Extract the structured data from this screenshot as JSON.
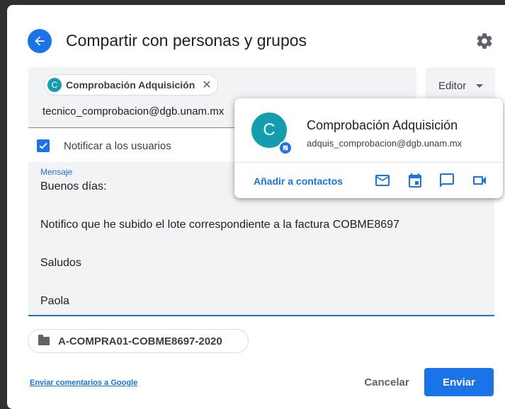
{
  "dialog": {
    "title": "Compartir con personas y grupos",
    "back_icon": "arrow-back-icon",
    "settings_icon": "gear-icon"
  },
  "recipients": {
    "chip": {
      "avatar_letter": "C",
      "label": "Comprobación Adquisición",
      "remove_icon": "close-icon"
    },
    "typed_value": "tecnico_comprobacion@dgb.unam.mx"
  },
  "role": {
    "selected": "Editor"
  },
  "notify": {
    "checked": true,
    "label": "Notificar a los usuarios"
  },
  "message": {
    "label": "Mensaje",
    "lines": [
      "Buenos días:",
      "Notifico que he subido el lote correspondiente a la factura COBME8697",
      "Saludos",
      "Paola"
    ]
  },
  "file": {
    "name": "A-COMPRA01-COBME8697-2020",
    "icon": "folder-icon"
  },
  "footer": {
    "feedback_link": "Enviar comentarios a Google",
    "cancel_label": "Cancelar",
    "send_label": "Enviar"
  },
  "contact_card": {
    "avatar_letter": "C",
    "name": "Comprobación Adquisición",
    "email": "adquis_comprobacion@dgb.unam.mx",
    "add_contacts_label": "Añadir a contactos",
    "actions": [
      "mail-icon",
      "calendar-icon",
      "chat-icon",
      "video-icon"
    ]
  },
  "colors": {
    "accent": "#1a73e8",
    "avatar": "#129eaf",
    "field_bg": "#f1f3f4"
  }
}
